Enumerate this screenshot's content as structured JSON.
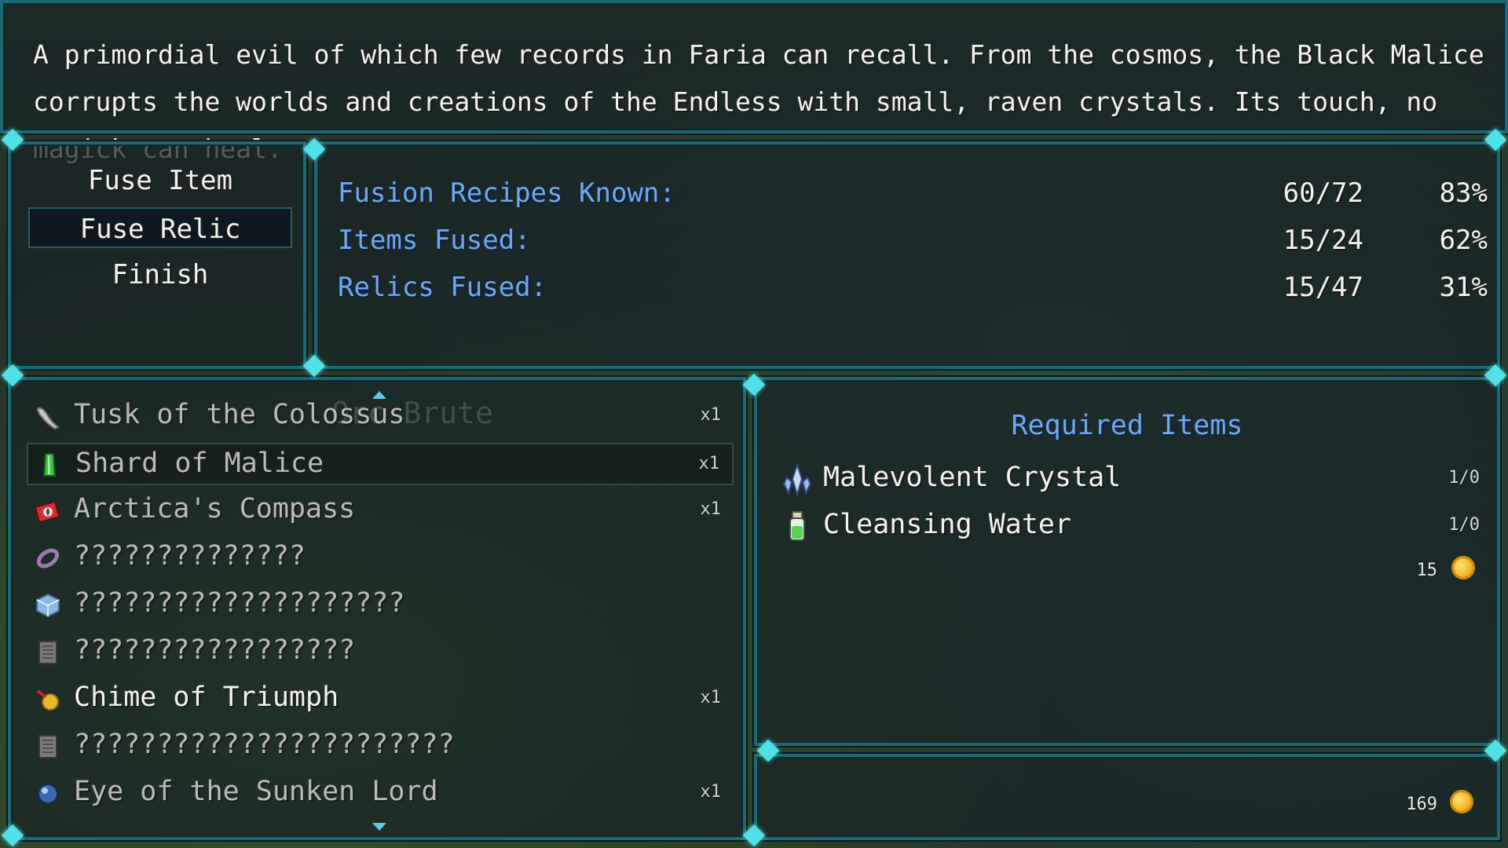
{
  "description": "A primordial evil of which few records in Faria can recall. From the cosmos, the Black Malice corrupts the worlds and creations of the Endless with small, raven crystals. Its touch, no magick can heal.",
  "menu": {
    "items": [
      {
        "label": "Fuse Item"
      },
      {
        "label": "Fuse Relic"
      },
      {
        "label": "Finish"
      }
    ]
  },
  "stats": [
    {
      "label": "Fusion Recipes Known:",
      "count": "60/72",
      "percent": "83%"
    },
    {
      "label": "Items Fused:",
      "count": "15/24",
      "percent": "62%"
    },
    {
      "label": "Relics Fused:",
      "count": "15/47",
      "percent": "31%"
    }
  ],
  "ghost_text": "Orc Brute",
  "items": [
    {
      "name": "Tusk of the Colossus",
      "qty": "x1",
      "icon": "tusk-icon"
    },
    {
      "name": "Shard of Malice",
      "qty": "x1",
      "icon": "green-crystal-icon"
    },
    {
      "name": "Arctica's Compass",
      "qty": "x1",
      "icon": "compass-icon"
    },
    {
      "name": "??????????????",
      "qty": "",
      "icon": "ring-icon"
    },
    {
      "name": "????????????????????",
      "qty": "",
      "icon": "ice-cube-icon"
    },
    {
      "name": "?????????????????",
      "qty": "",
      "icon": "tablet-icon"
    },
    {
      "name": "Chime of Triumph",
      "qty": "x1",
      "icon": "chime-icon"
    },
    {
      "name": "???????????????????????",
      "qty": "",
      "icon": "tablet-icon"
    },
    {
      "name": "Eye of the Sunken Lord",
      "qty": "x1",
      "icon": "orb-icon"
    }
  ],
  "required": {
    "title": "Required Items",
    "items": [
      {
        "name": "Malevolent Crystal",
        "count": "1/0",
        "icon": "dark-crystal-icon"
      },
      {
        "name": "Cleansing Water",
        "count": "1/0",
        "icon": "potion-icon"
      }
    ],
    "gold_cost": "15"
  },
  "gold_total": "169",
  "colors": {
    "border": "#1d6a72",
    "ornament": "#4fe0e8",
    "label_blue": "#6ea8f2",
    "coin": "#f2b21c"
  }
}
